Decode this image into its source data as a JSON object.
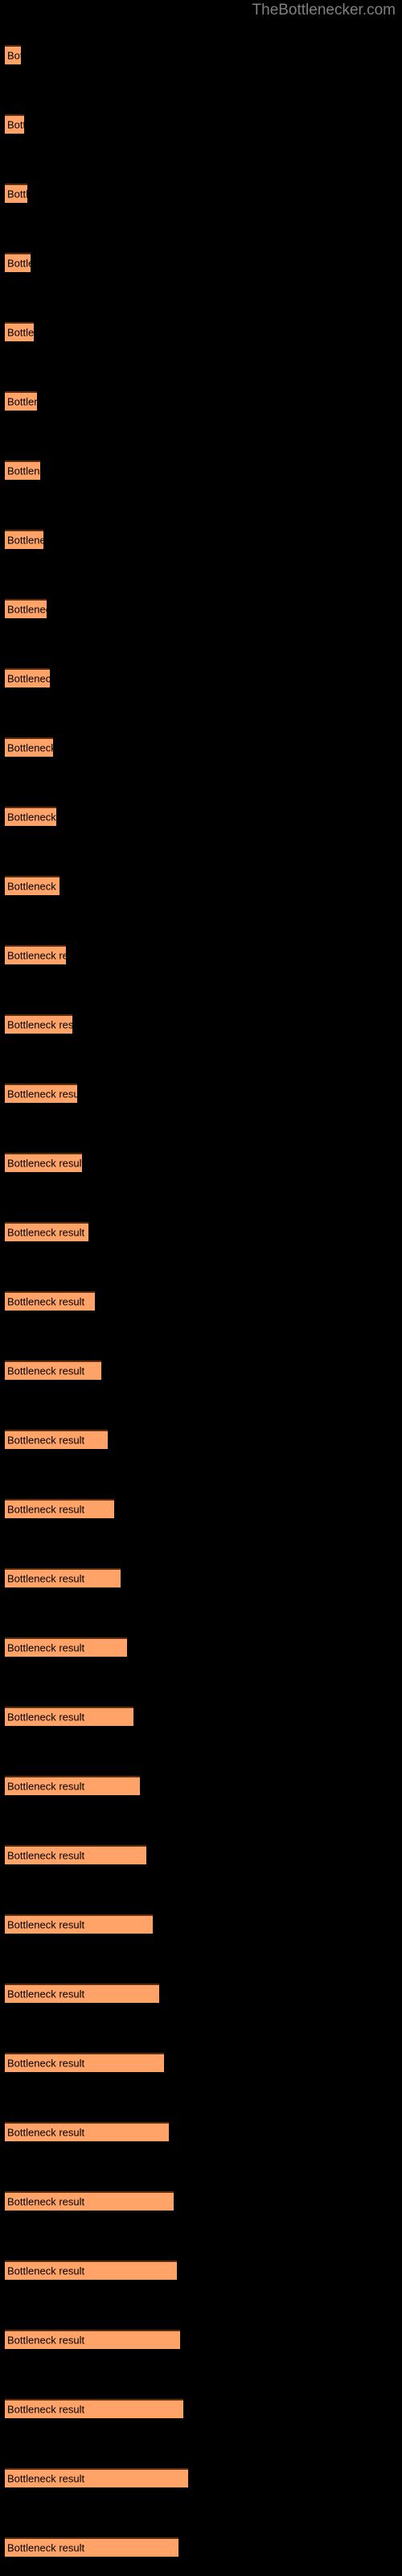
{
  "site": {
    "title": "TheBottlenecker.com"
  },
  "chart_data": {
    "type": "bar",
    "orientation": "horizontal",
    "title": "",
    "subtitle": "",
    "xlabel": "",
    "ylabel": "",
    "grid": false,
    "legend": null,
    "background_color": "#000000",
    "bar_color": "#FFA368",
    "bar_border_color": "#5A2C0B",
    "label_color": "#000000",
    "title_color": "#808080",
    "bar_label_text": "Bottleneck result",
    "categories": [
      "Bottleneck result",
      "Bottleneck result",
      "Bottleneck result",
      "Bottleneck result",
      "Bottleneck result",
      "Bottleneck result",
      "Bottleneck result",
      "Bottleneck result",
      "Bottleneck result",
      "Bottleneck result",
      "Bottleneck result",
      "Bottleneck result",
      "Bottleneck result",
      "Bottleneck result",
      "Bottleneck result",
      "Bottleneck result",
      "Bottleneck result",
      "Bottleneck result",
      "Bottleneck result",
      "Bottleneck result",
      "Bottleneck result",
      "Bottleneck result",
      "Bottleneck result",
      "Bottleneck result",
      "Bottleneck result",
      "Bottleneck result",
      "Bottleneck result",
      "Bottleneck result",
      "Bottleneck result",
      "Bottleneck result",
      "Bottleneck result",
      "Bottleneck result",
      "Bottleneck result",
      "Bottleneck result",
      "Bottleneck result",
      "Bottleneck result",
      "Bottleneck result"
    ],
    "values": [
      14,
      18,
      22,
      26,
      30,
      34,
      38,
      42,
      46,
      50,
      54,
      58,
      62,
      68,
      74,
      80,
      86,
      94,
      102,
      110,
      118,
      126,
      134,
      142,
      150,
      158,
      166,
      174,
      182,
      190,
      196,
      202,
      208,
      214,
      218,
      222,
      216
    ],
    "bar_pixel_widths": [
      20,
      24,
      28,
      32,
      36,
      40,
      44,
      48,
      52,
      56,
      60,
      64,
      68,
      76,
      84,
      90,
      96,
      104,
      112,
      120,
      128,
      136,
      144,
      152,
      160,
      168,
      176,
      184,
      192,
      198,
      204,
      210,
      214,
      218,
      222,
      228,
      216
    ],
    "bar_pixel_tops": [
      56,
      142,
      228,
      314,
      400,
      486,
      572,
      658,
      744,
      830,
      916,
      1002,
      1088,
      1174,
      1260,
      1346,
      1432,
      1518,
      1604,
      1690,
      1776,
      1862,
      1948,
      2034,
      2120,
      2206,
      2292,
      2378,
      2464,
      2550,
      2636,
      2722,
      2808,
      2894,
      2980,
      3066,
      3152
    ],
    "xlim": [
      0,
      230
    ],
    "bar_count": 37
  }
}
